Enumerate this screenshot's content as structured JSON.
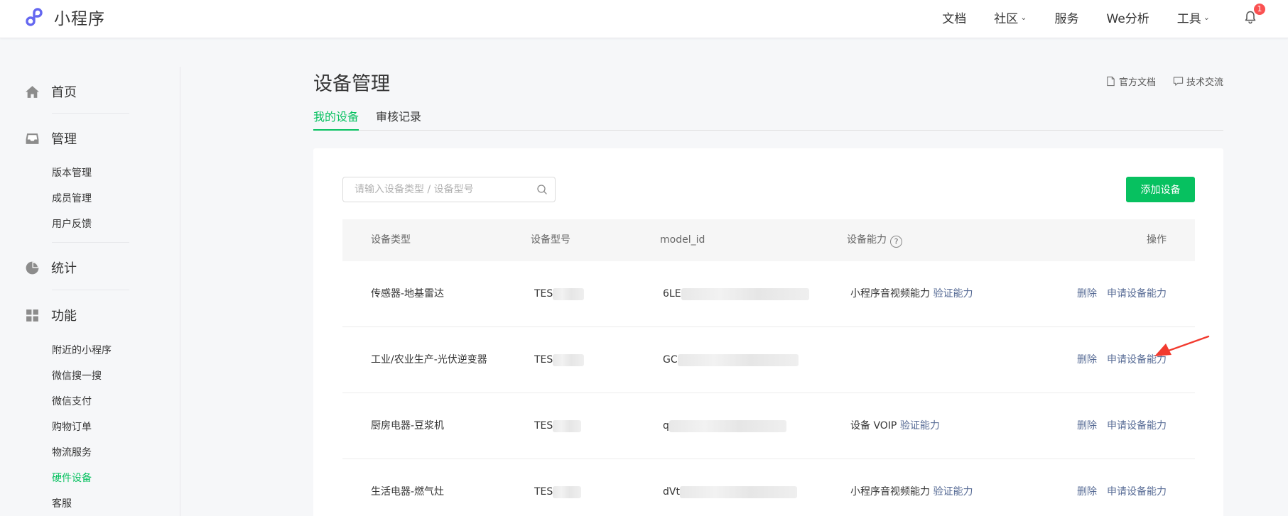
{
  "app": {
    "logo_text": "小程序",
    "brand_color": "#07c160",
    "nav": [
      {
        "label": "文档"
      },
      {
        "label": "社区",
        "has_dropdown": true
      },
      {
        "label": "服务"
      },
      {
        "label": "We分析"
      },
      {
        "label": "工具",
        "has_dropdown": true
      }
    ],
    "notifications": "1"
  },
  "sidebar": {
    "groups": [
      {
        "label": "首页",
        "icon": "home-icon"
      },
      {
        "label": "管理",
        "icon": "inbox-icon",
        "items": [
          "版本管理",
          "成员管理",
          "用户反馈"
        ]
      },
      {
        "label": "统计",
        "icon": "pie-chart-icon"
      },
      {
        "label": "功能",
        "icon": "grid-icon",
        "items": [
          "附近的小程序",
          "微信搜一搜",
          "微信支付",
          "购物订单",
          "物流服务",
          "硬件设备",
          "客服"
        ]
      }
    ],
    "active_item": "硬件设备"
  },
  "main": {
    "title": "设备管理",
    "links": [
      {
        "label": "官方文档",
        "icon": "document-icon"
      },
      {
        "label": "技术交流",
        "icon": "chat-icon"
      }
    ],
    "tabs": [
      {
        "label": "我的设备",
        "active": true
      },
      {
        "label": "审核记录",
        "active": false
      }
    ],
    "search_placeholder": "请输入设备类型 / 设备型号",
    "add_button": "添加设备",
    "table": {
      "columns": [
        "设备类型",
        "设备型号",
        "model_id",
        "设备能力",
        "操作"
      ],
      "help_icon": "?",
      "rows": [
        {
          "type": "传感器-地基雷达",
          "model": "TES",
          "model_id": "6LE",
          "ability": "小程序音视频能力",
          "ability_link": "验证能力",
          "delete": "删除",
          "apply": "申请设备能力"
        },
        {
          "type": "工业/农业生产-光伏逆变器",
          "model": "TES",
          "model_id": "GC",
          "ability": "",
          "ability_link": "",
          "delete": "删除",
          "apply": "申请设备能力"
        },
        {
          "type": "厨房电器-豆浆机",
          "model": "TES",
          "model_id": "q",
          "ability": "设备 VOIP",
          "ability_link": "验证能力",
          "delete": "删除",
          "apply": "申请设备能力"
        },
        {
          "type": "生活电器-燃气灶",
          "model": "TES",
          "model_id": "dVt",
          "ability": "小程序音视频能力",
          "ability_link": "验证能力",
          "delete": "删除",
          "apply": "申请设备能力"
        }
      ]
    }
  }
}
